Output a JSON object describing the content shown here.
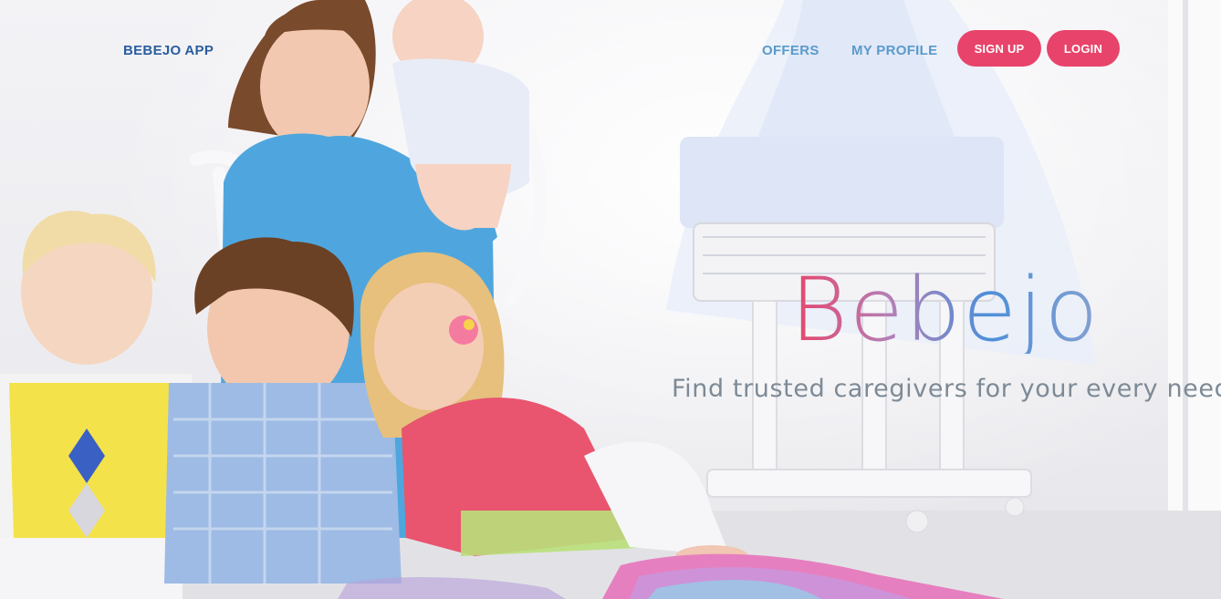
{
  "nav": {
    "brand": "BEBEJO APP",
    "links": [
      {
        "label": "OFFERS"
      },
      {
        "label": "MY PROFILE"
      }
    ],
    "buttons": {
      "signup_label": "SIGN UP",
      "login_label": "LOGIN"
    }
  },
  "hero": {
    "headline": "Bebejo",
    "tagline": "Find trusted caregivers for your every need!"
  },
  "colors": {
    "accent": "#e8436a",
    "brand": "#2a5d9e",
    "nav_link": "#5a9acb",
    "tagline": "#7d8a96"
  }
}
